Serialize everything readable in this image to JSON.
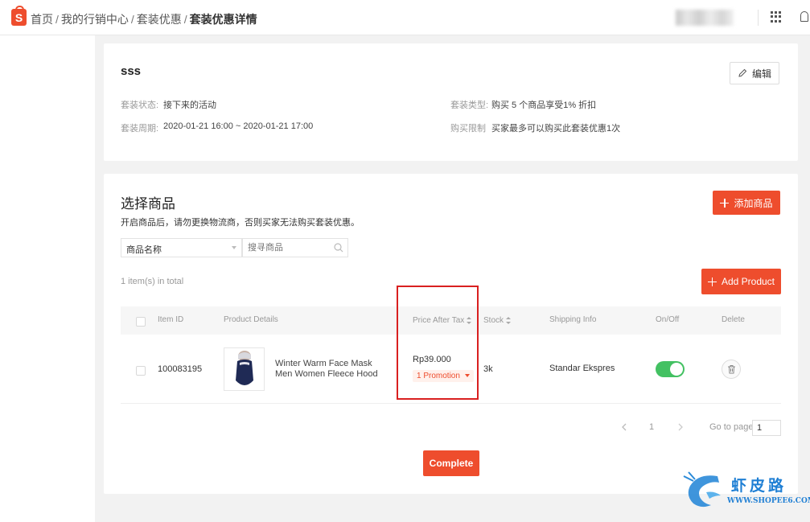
{
  "breadcrumb": [
    "首页",
    "我的行销中心",
    "套装优惠",
    "套装优惠详情"
  ],
  "bundle": {
    "name": "sss",
    "edit_label": "编辑",
    "status_label": "套装状态:",
    "status_value": "接下来的活动",
    "period_label": "套装周期:",
    "period_value": "2020-01-21 16:00 ~ 2020-01-21 17:00",
    "type_label": "套装类型:",
    "type_value": "购买 5 个商品享受1% 折扣",
    "limit_label": "购买限制",
    "limit_value": "买家最多可以购买此套装优惠1次"
  },
  "products": {
    "title": "选择商品",
    "hint": "开启商品后，请勿更换物流商，否则买家无法购买套装优惠。",
    "add_cn_label": "添加商品",
    "filter_option": "商品名称",
    "search_placeholder": "搜寻商品",
    "total_text": "1 item(s) in total",
    "add_en_label": "Add Product",
    "columns": [
      "Item ID",
      "Product Details",
      "Price After Tax",
      "Stock",
      "Shipping Info",
      "On/Off",
      "Delete"
    ],
    "rows": [
      {
        "item_id": "100083195",
        "name": "Winter Warm Face Mask Men Women Fleece Hood Winter...",
        "price": "Rp39.000",
        "promotion": "1 Promotion",
        "stock": "3k",
        "shipping": "Standar Ekspres",
        "enabled": true
      }
    ]
  },
  "pagination": {
    "current_page": "1",
    "goto_label": "Go to page",
    "goto_value": "1"
  },
  "complete_label": "Complete",
  "watermark": {
    "brand": "虾皮路",
    "url": "WWW.SHOPEE6.COM"
  },
  "colors": {
    "accent": "#ee4d2d",
    "toggle_on": "#43c162",
    "highlight_box": "#d92020"
  },
  "icons": [
    "shopee-logo-icon",
    "apps-grid-icon",
    "bell-icon",
    "pencil-icon",
    "plus-icon",
    "caret-down-icon",
    "search-icon",
    "sort-icon",
    "chevron-left-icon",
    "chevron-right-icon",
    "trash-icon"
  ]
}
